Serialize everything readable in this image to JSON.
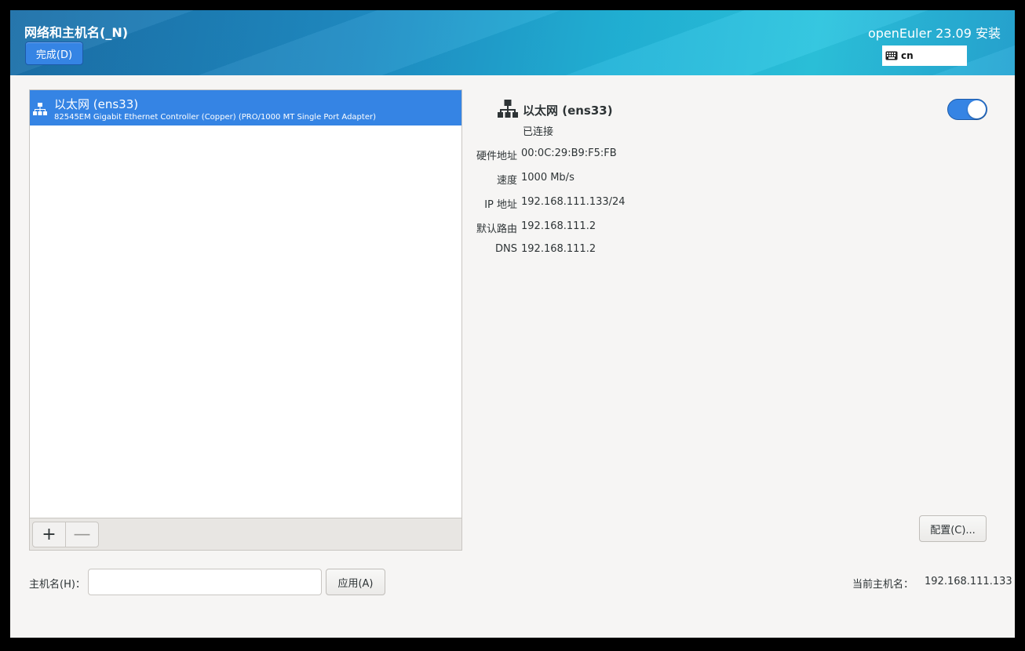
{
  "header": {
    "title": "网络和主机名(_N)",
    "done_label": "完成(D)",
    "product": "openEuler 23.09 安装",
    "keyboard_layout": "cn",
    "keyboard_icon": "keyboard-icon"
  },
  "device_list": {
    "items": [
      {
        "name": "以太网 (ens33)",
        "description": "82545EM Gigabit Ethernet Controller (Copper) (PRO/1000 MT Single Port Adapter)",
        "icon": "network-wired-icon"
      }
    ],
    "add_label": "+",
    "remove_label": "—"
  },
  "device_details": {
    "name": "以太网 (ens33)",
    "status": "已连接",
    "enabled": true,
    "properties": [
      {
        "label": "硬件地址",
        "value": "00:0C:29:B9:F5:FB"
      },
      {
        "label": "速度",
        "value": "1000 Mb/s"
      },
      {
        "label": "IP 地址",
        "value": "192.168.111.133/24"
      },
      {
        "label": "默认路由",
        "value": "192.168.111.2"
      },
      {
        "label": "DNS",
        "value": "192.168.111.2"
      }
    ],
    "config_label": "配置(C)..."
  },
  "hostname": {
    "label": "主机名(H)：",
    "value": "",
    "apply_label": "应用(A)",
    "current_label": "当前主机名：",
    "current_value": "192.168.111.133"
  },
  "colors": {
    "accent": "#3584e4",
    "header_gradient_start": "#1b6fa8",
    "header_gradient_end": "#2bc4de"
  }
}
